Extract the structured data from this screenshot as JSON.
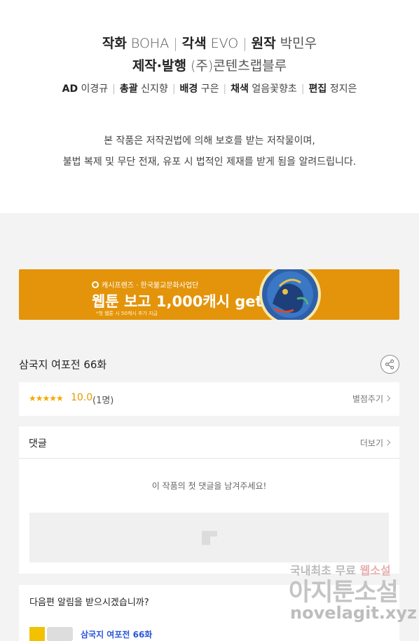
{
  "credits": {
    "line1": [
      {
        "role": "작화",
        "name": "BOHA"
      },
      {
        "role": "각색",
        "name": "EVO"
      },
      {
        "role": "원작",
        "name": "박민우"
      }
    ],
    "line2": {
      "role": "제작·발행",
      "name": "(주)콘텐츠랩블루"
    },
    "line3": [
      {
        "role": "AD",
        "name": "이경규"
      },
      {
        "role": "총괄",
        "name": "신지향"
      },
      {
        "role": "배경",
        "name": "구은"
      },
      {
        "role": "채색",
        "name": "얼음꽃향초"
      },
      {
        "role": "편집",
        "name": "정지은"
      }
    ],
    "separator": "|",
    "notice_line1": "본 작품은 저작권법에 의해 보호를 받는 저작물이며,",
    "notice_line2": "불법 복제 및 무단 전재, 유포 시 법적인 제재를 받게 됨을 알려드립니다."
  },
  "banner": {
    "small": "캐시프렌즈 · 한국불교문화사업단",
    "headline": "웹툰 보고 1,000캐시 get!",
    "fine": "*첫 웹툰 시 50캐시 추가 지급",
    "bg_color": "#e3940a"
  },
  "episode": {
    "title": "삼국지 여포전 66화",
    "share_icon": "share-icon"
  },
  "rating": {
    "stars": "★★★★★",
    "score": "10.0",
    "count": "(1명)",
    "rate_link": "별점주기"
  },
  "comments": {
    "heading": "댓글",
    "more_link": "더보기",
    "empty_text": "이 작품의 첫 댓글을 남겨주세요!"
  },
  "notify": {
    "question": "다음편 알림을 받으시겠습니까?",
    "title": "삼국지 여포전 66화"
  },
  "watermark": {
    "top_a": "국내최초 무료 ",
    "top_b": "웹소설",
    "main": "아지툰소설",
    "url": "novelagit.xyz"
  }
}
